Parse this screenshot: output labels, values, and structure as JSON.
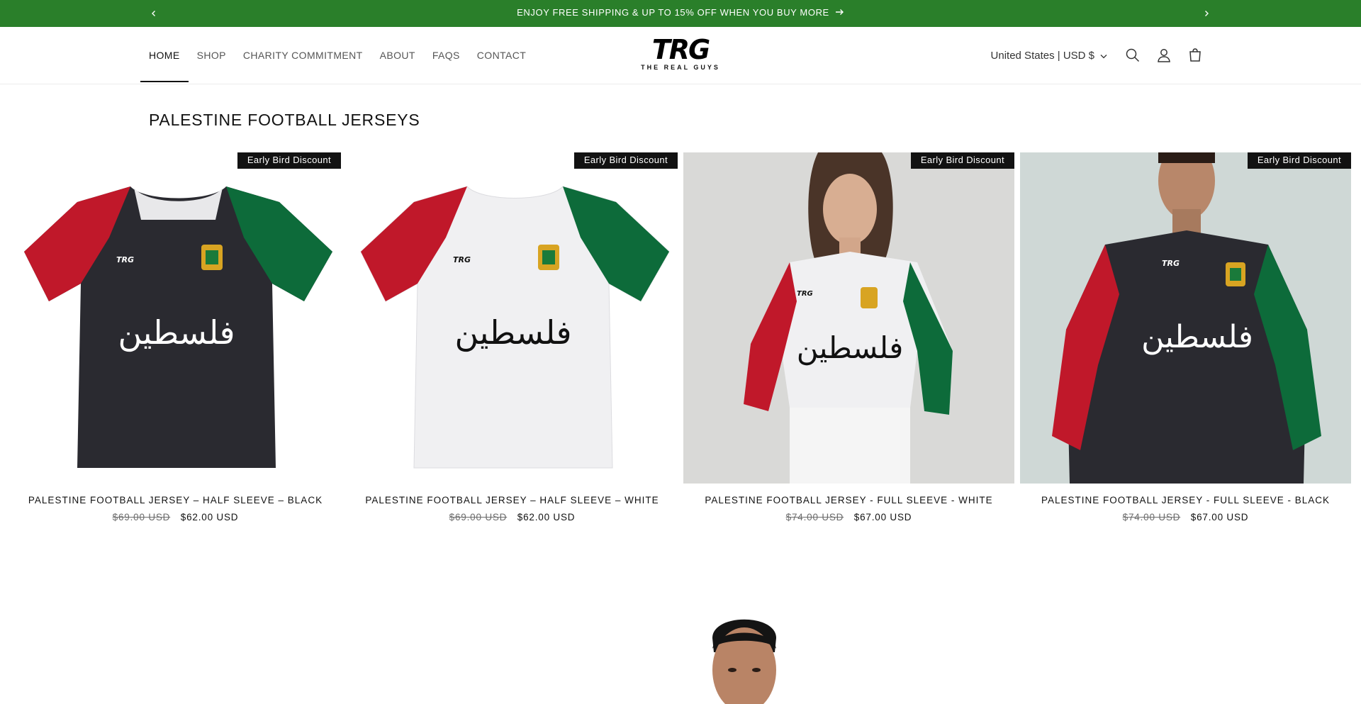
{
  "announcement": {
    "text": "ENJOY FREE SHIPPING & UP TO 15% OFF WHEN YOU BUY MORE",
    "prev_icon": "chevron-left-icon",
    "next_icon": "chevron-right-icon",
    "arrow_icon": "arrow-right-icon",
    "background_color": "#2a7f2a"
  },
  "nav": {
    "items": [
      {
        "label": "HOME"
      },
      {
        "label": "SHOP"
      },
      {
        "label": "CHARITY COMMITMENT"
      },
      {
        "label": "ABOUT"
      },
      {
        "label": "FAQS"
      },
      {
        "label": "CONTACT"
      }
    ],
    "active": "HOME"
  },
  "logo": {
    "mark": "TRG",
    "tagline": "THE REAL GUYS"
  },
  "header_tools": {
    "country": "United States | USD $",
    "icons": [
      "search-icon",
      "account-icon",
      "cart-icon"
    ]
  },
  "section": {
    "title": "PALESTINE FOOTBALL JERSEYS"
  },
  "products": [
    {
      "badge": "Early Bird Discount",
      "name": "PALESTINE FOOTBALL JERSEY – HALF SLEEVE – BLACK",
      "old_price": "$69.00 USD",
      "price": "$62.00 USD",
      "body_color": "#2a2a30",
      "script": "فلسطين"
    },
    {
      "badge": "Early Bird Discount",
      "name": "PALESTINE FOOTBALL JERSEY – HALF SLEEVE – WHITE",
      "old_price": "$69.00 USD",
      "price": "$62.00 USD",
      "body_color": "#f2f2f4",
      "script": "فلسطين"
    },
    {
      "badge": "Early Bird Discount",
      "name": "PALESTINE FOOTBALL JERSEY - FULL SLEEVE - WHITE",
      "old_price": "$74.00 USD",
      "price": "$67.00 USD",
      "body_color": "#f2f2f4",
      "script": "فلسطين"
    },
    {
      "badge": "Early Bird Discount",
      "name": "PALESTINE FOOTBALL JERSEY - FULL SLEEVE - BLACK",
      "old_price": "$74.00 USD",
      "price": "$67.00 USD",
      "body_color": "#2a2a30",
      "script": "فلسطين"
    }
  ]
}
